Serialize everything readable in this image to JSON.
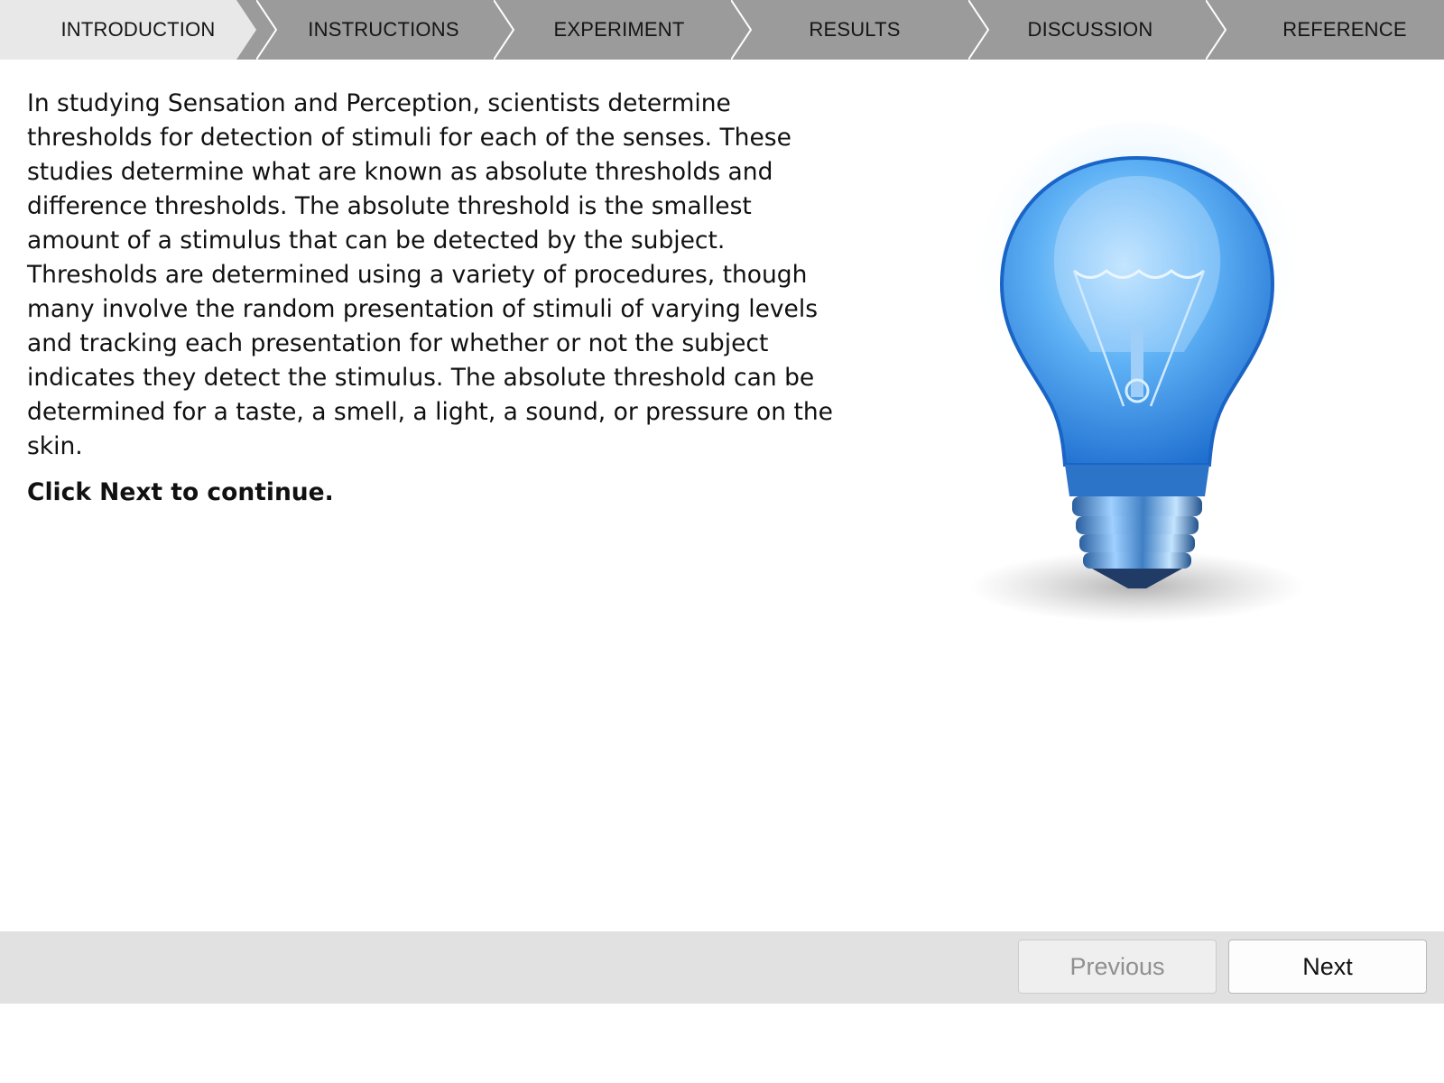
{
  "tabs": [
    {
      "label": "INTRODUCTION",
      "active": true
    },
    {
      "label": "INSTRUCTIONS",
      "active": false
    },
    {
      "label": "EXPERIMENT",
      "active": false
    },
    {
      "label": "RESULTS",
      "active": false
    },
    {
      "label": "DISCUSSION",
      "active": false
    },
    {
      "label": "REFERENCE",
      "active": false
    }
  ],
  "content": {
    "paragraph": "In studying Sensation and Perception, scientists determine thresholds for detection of stimuli for each of the senses. These studies determine what are known as absolute thresholds and difference thresholds. The absolute threshold is the smallest amount of a stimulus that can be detected by the subject. Thresholds are determined using a variety of procedures, though many involve the random presentation of stimuli of varying levels and tracking each presentation for whether or not the subject indicates they detect the stimulus. The absolute threshold can be determined for a taste, a smell, a light, a sound, or pressure on the skin.",
    "instruction": "Click Next to continue.",
    "illustration_icon": "lightbulb-icon"
  },
  "footer": {
    "previous_label": "Previous",
    "next_label": "Next",
    "previous_enabled": false
  },
  "colors": {
    "tab_active_bg": "#e8e8e8",
    "tab_inactive_bg": "#9b9b9b",
    "tab_separator": "#ffffff",
    "footer_bg": "#e1e1e1",
    "bulb_blue": "#2e8ee8"
  }
}
